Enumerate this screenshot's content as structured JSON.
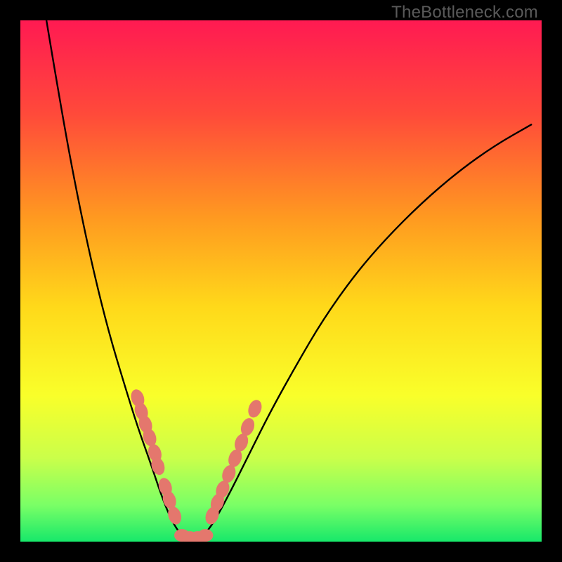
{
  "watermark": "TheBottleneck.com",
  "chart_data": {
    "type": "line",
    "title": "",
    "xlabel": "",
    "ylabel": "",
    "xlim": [
      0,
      100
    ],
    "ylim": [
      0,
      100
    ],
    "grid": false,
    "legend": false,
    "background_gradient": {
      "stops": [
        {
          "offset": 0.0,
          "color": "#ff1a52"
        },
        {
          "offset": 0.18,
          "color": "#ff4a3a"
        },
        {
          "offset": 0.38,
          "color": "#ff9a20"
        },
        {
          "offset": 0.55,
          "color": "#ffd91a"
        },
        {
          "offset": 0.72,
          "color": "#f9ff2a"
        },
        {
          "offset": 0.84,
          "color": "#caff4a"
        },
        {
          "offset": 0.93,
          "color": "#7aff66"
        },
        {
          "offset": 1.0,
          "color": "#17e86a"
        }
      ]
    },
    "series": [
      {
        "name": "bottleneck-curve",
        "points": [
          {
            "x": 5.0,
            "y": 100.0
          },
          {
            "x": 8.0,
            "y": 82.0
          },
          {
            "x": 11.0,
            "y": 66.0
          },
          {
            "x": 14.0,
            "y": 52.0
          },
          {
            "x": 17.0,
            "y": 40.0
          },
          {
            "x": 20.0,
            "y": 30.0
          },
          {
            "x": 22.5,
            "y": 22.0
          },
          {
            "x": 25.0,
            "y": 15.0
          },
          {
            "x": 27.0,
            "y": 9.0
          },
          {
            "x": 29.0,
            "y": 4.0
          },
          {
            "x": 31.0,
            "y": 1.0
          },
          {
            "x": 33.0,
            "y": 0.5
          },
          {
            "x": 35.0,
            "y": 1.0
          },
          {
            "x": 37.0,
            "y": 3.5
          },
          {
            "x": 40.0,
            "y": 9.0
          },
          {
            "x": 44.0,
            "y": 17.0
          },
          {
            "x": 48.0,
            "y": 25.0
          },
          {
            "x": 53.0,
            "y": 34.0
          },
          {
            "x": 58.0,
            "y": 42.5
          },
          {
            "x": 64.0,
            "y": 51.0
          },
          {
            "x": 70.0,
            "y": 58.0
          },
          {
            "x": 77.0,
            "y": 65.0
          },
          {
            "x": 84.0,
            "y": 71.0
          },
          {
            "x": 91.0,
            "y": 76.0
          },
          {
            "x": 98.0,
            "y": 80.0
          }
        ]
      }
    ],
    "blobs_left": [
      {
        "x": 22.5,
        "y": 27.5
      },
      {
        "x": 23.2,
        "y": 25.0
      },
      {
        "x": 24.0,
        "y": 22.5
      },
      {
        "x": 24.8,
        "y": 20.0
      },
      {
        "x": 25.8,
        "y": 17.0
      },
      {
        "x": 26.4,
        "y": 14.5
      },
      {
        "x": 27.8,
        "y": 10.5
      },
      {
        "x": 28.6,
        "y": 8.0
      },
      {
        "x": 29.6,
        "y": 5.0
      }
    ],
    "blobs_right": [
      {
        "x": 36.8,
        "y": 5.0
      },
      {
        "x": 37.8,
        "y": 7.5
      },
      {
        "x": 38.8,
        "y": 10.0
      },
      {
        "x": 40.0,
        "y": 13.0
      },
      {
        "x": 41.2,
        "y": 16.0
      },
      {
        "x": 42.4,
        "y": 19.0
      },
      {
        "x": 43.6,
        "y": 22.0
      },
      {
        "x": 45.0,
        "y": 25.5
      }
    ],
    "blobs_bottom": [
      {
        "x": 31.0,
        "y": 1.2
      },
      {
        "x": 32.5,
        "y": 0.8
      },
      {
        "x": 34.0,
        "y": 0.8
      },
      {
        "x": 35.5,
        "y": 1.2
      }
    ]
  }
}
